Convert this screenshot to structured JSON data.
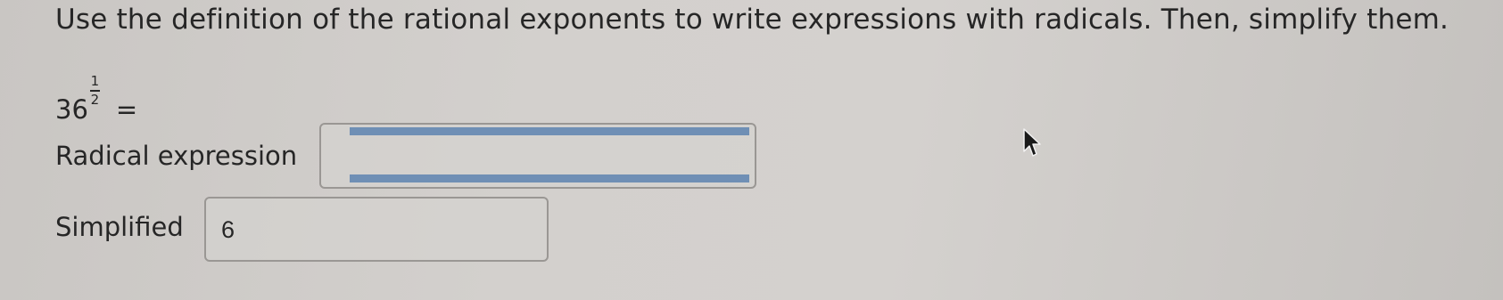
{
  "instruction": "Use the definition of the rational exponents to write expressions with radicals. Then, simplify them.",
  "expression": {
    "base": "36",
    "exponent_numerator": "1",
    "exponent_denominator": "2",
    "equals": "="
  },
  "radical_expression": {
    "label": "Radical expression",
    "value": ""
  },
  "simplified": {
    "label": "Simplified",
    "value": "6"
  },
  "icons": {
    "cursor": "mouse-pointer-icon"
  }
}
